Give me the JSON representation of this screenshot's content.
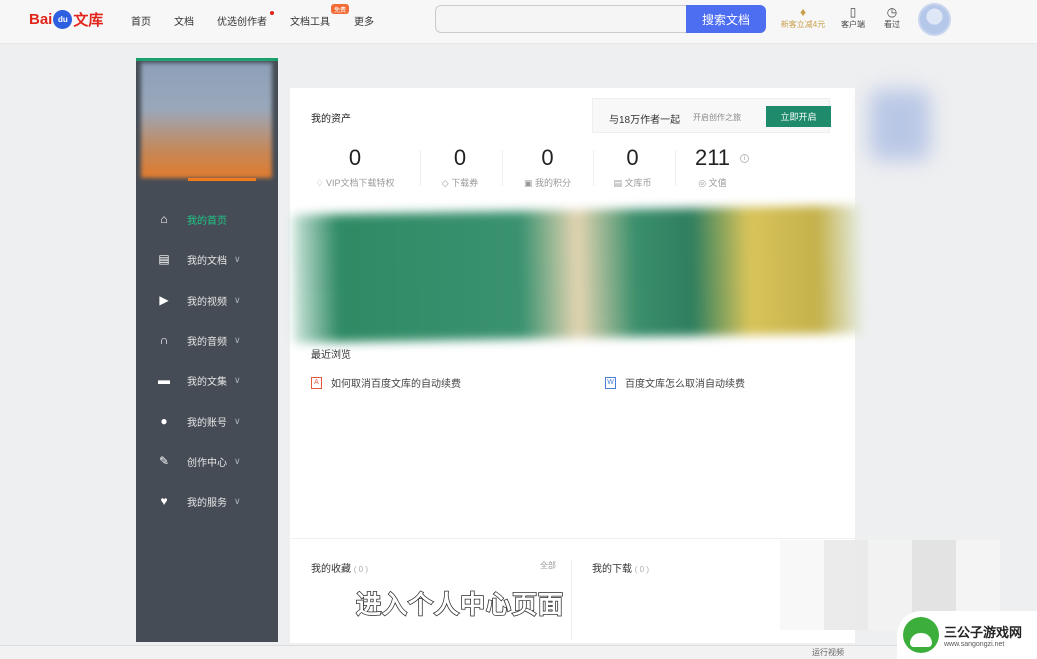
{
  "header": {
    "logo": {
      "bai": "Bai",
      "paw": "du",
      "wenku": "文库"
    },
    "nav": [
      "首页",
      "文档",
      "优选创作者",
      "文档工具",
      "更多"
    ],
    "new_badge": "免费",
    "search": {
      "placeholder": "",
      "button": "搜索文档"
    },
    "vip_label": "新客立减4元",
    "client_label": "客户端",
    "history_label": "看过"
  },
  "sidebar": {
    "items": [
      {
        "label": "我的首页",
        "icon": "home-icon",
        "active": true
      },
      {
        "label": "我的文档",
        "icon": "document-icon"
      },
      {
        "label": "我的视频",
        "icon": "video-icon"
      },
      {
        "label": "我的音频",
        "icon": "headphones-icon"
      },
      {
        "label": "我的文集",
        "icon": "folder-icon"
      },
      {
        "label": "我的账号",
        "icon": "user-icon"
      },
      {
        "label": "创作中心",
        "icon": "pen-icon"
      },
      {
        "label": "我的服务",
        "icon": "heart-icon"
      }
    ]
  },
  "assets": {
    "title": "我的资产",
    "promo": {
      "main": "与18万作者一起",
      "sub": "开启创作之旅",
      "button": "立即开启"
    },
    "stats": [
      {
        "value": "0",
        "label": "VIP文档下载特权"
      },
      {
        "value": "0",
        "label": "下载券"
      },
      {
        "value": "0",
        "label": "我的积分"
      },
      {
        "value": "0",
        "label": "文库币"
      },
      {
        "value": "211",
        "label": "文值"
      }
    ],
    "info_mark": "i"
  },
  "recent": {
    "title": "最近浏览",
    "docs": [
      {
        "title": "如何取消百度文库的自动续费",
        "type": "pdf",
        "type_mark": "A"
      },
      {
        "title": "百度文库怎么取消自动续费",
        "type": "word",
        "type_mark": "W"
      }
    ]
  },
  "favorites": {
    "title": "我的收藏",
    "count": "( 0 )",
    "all": "全部"
  },
  "downloads": {
    "title": "我的下载",
    "count": "( 0 )"
  },
  "caption": "进入个人中心页面",
  "watermark": {
    "name": "三公子游戏网",
    "url": "www.sangongzi.net"
  },
  "status_text": "运行视频"
}
